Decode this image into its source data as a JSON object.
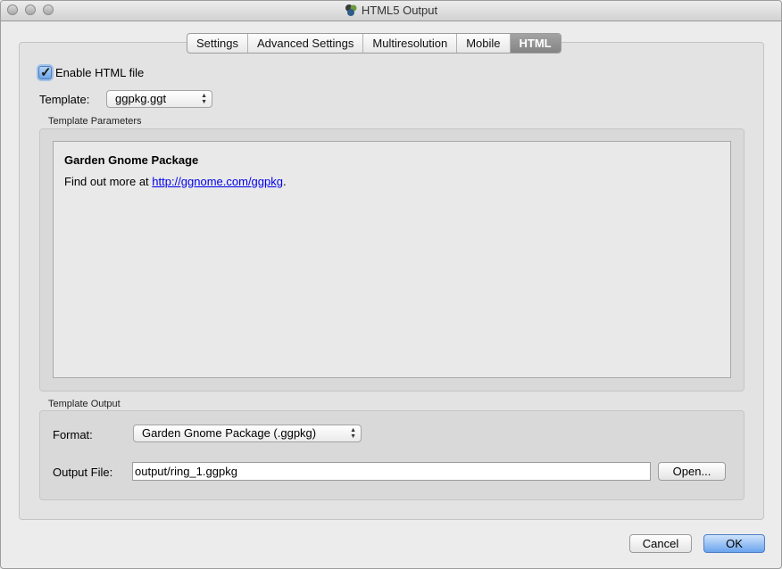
{
  "window": {
    "title": "HTML5 Output"
  },
  "tabs": [
    "Settings",
    "Advanced Settings",
    "Multiresolution",
    "Mobile",
    "HTML"
  ],
  "enable_html": {
    "label": "Enable HTML file",
    "checked": true
  },
  "template": {
    "label": "Template:",
    "value": "ggpkg.ggt"
  },
  "template_parameters": {
    "title": "Template Parameters",
    "heading": "Garden Gnome Package",
    "text_before_link": "Find out more at ",
    "link": "http://ggnome.com/ggpkg",
    "text_after_link": "."
  },
  "template_output": {
    "title": "Template Output",
    "format_label": "Format:",
    "format_value": "Garden Gnome Package (.ggpkg)",
    "output_label": "Output File:",
    "output_value": "output/ring_1.ggpkg",
    "open_button": "Open..."
  },
  "buttons": {
    "cancel": "Cancel",
    "ok": "OK"
  }
}
